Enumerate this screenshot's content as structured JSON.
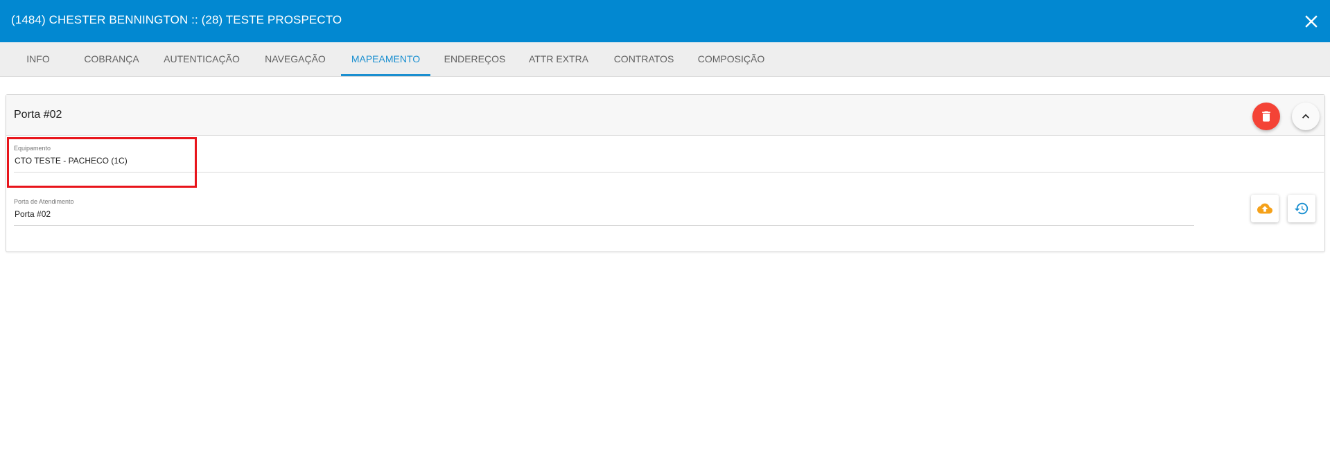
{
  "dialog": {
    "title": "(1484) CHESTER BENNINGTON :: (28) TESTE PROSPECTO"
  },
  "tabs": [
    {
      "label": "INFO"
    },
    {
      "label": "COBRANÇA"
    },
    {
      "label": "AUTENTICAÇÃO"
    },
    {
      "label": "NAVEGAÇÃO"
    },
    {
      "label": "MAPEAMENTO",
      "active": true
    },
    {
      "label": "ENDEREÇOS"
    },
    {
      "label": "ATTR EXTRA"
    },
    {
      "label": "CONTRATOS"
    },
    {
      "label": "COMPOSIÇÃO"
    }
  ],
  "card": {
    "title": "Porta #02",
    "equipamento": {
      "label": "Equipamento",
      "value": "CTO TESTE - PACHECO (1C)"
    },
    "porta": {
      "label": "Porta de Atendimento",
      "value": "Porta #02"
    }
  },
  "icons": {
    "close": "close-icon",
    "delete": "trash-icon",
    "collapse": "chevron-up-icon",
    "upload": "cloud-upload-icon",
    "history": "history-icon"
  },
  "colors": {
    "header": "#0288d1",
    "active_tab": "#1a8fd0",
    "delete": "#f44336",
    "upload": "#f5a11a",
    "history": "#1a8fd0",
    "highlight": "#e8141b"
  }
}
